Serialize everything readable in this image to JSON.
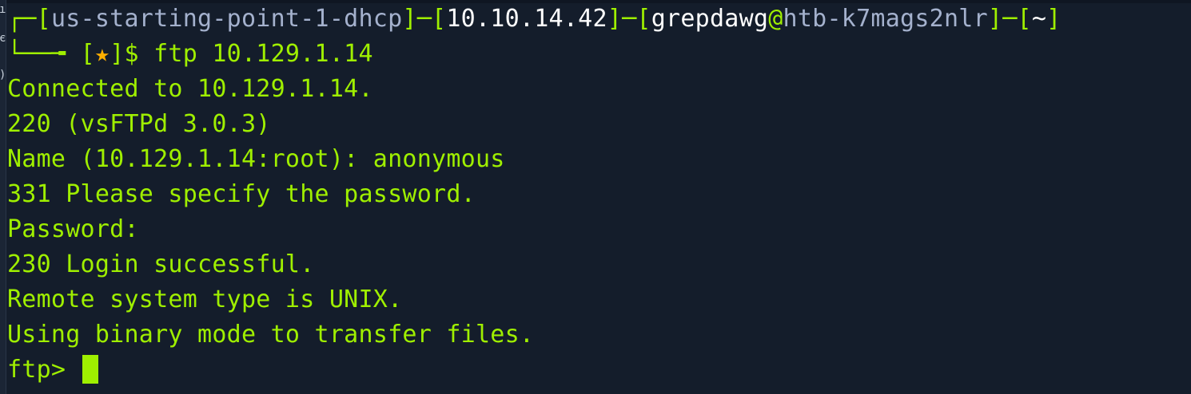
{
  "prompt": {
    "frame_top_open": "┌─[",
    "host_tag": "us-starting-point-1-dhcp",
    "sep1": "]─[",
    "ip": "10.10.14.42",
    "sep2": "]─[",
    "user": "grepdawg",
    "at": "@",
    "host": "htb-k7mags2nlr",
    "sep3": "]─[",
    "cwd": "~",
    "frame_top_close": "]",
    "frame_bottom": "└──╼ ",
    "bracket_open": "[",
    "star": "★",
    "bracket_close": "]$ ",
    "command": "ftp 10.129.1.14"
  },
  "output": [
    "Connected to 10.129.1.14.",
    "220 (vsFTPd 3.0.3)",
    "Name (10.129.1.14:root): anonymous",
    "331 Please specify the password.",
    "Password:",
    "230 Login successful.",
    "Remote system type is UNIX.",
    "Using binary mode to transfer files."
  ],
  "ftp_prompt": "ftp> ",
  "colors": {
    "background": "#141d2b",
    "accent_green": "#9fef00",
    "host_blue": "#a4b1cd",
    "white": "#ffffff"
  }
}
